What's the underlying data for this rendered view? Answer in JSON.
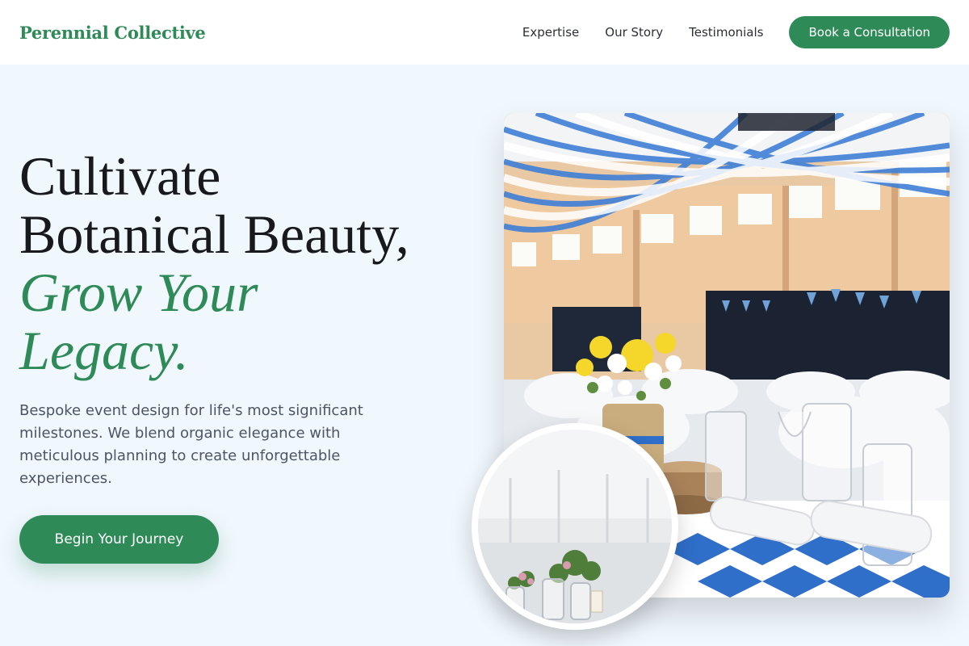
{
  "header": {
    "brand": "Perennial Collective",
    "nav": [
      "Expertise",
      "Our Story",
      "Testimonials"
    ],
    "cta_label": "Book a Consultation"
  },
  "hero": {
    "title_line1": "Cultivate",
    "title_line2": "Botanical Beauty,",
    "title_accent1": "Grow Your",
    "title_accent2": "Legacy.",
    "subtitle": "Bespoke event design for life's most significant milestones. We blend organic elegance with meticulous planning to create unforgettable experiences.",
    "button_label": "Begin Your Journey"
  },
  "images": {
    "main": "event-hall-photo",
    "inset": "table-centerpiece-photo"
  },
  "colors": {
    "accent": "#2e8b57",
    "background": "#f0f7fd",
    "header_bg": "#ffffff",
    "text_dark": "#17191c",
    "text_muted": "#4b5563"
  }
}
